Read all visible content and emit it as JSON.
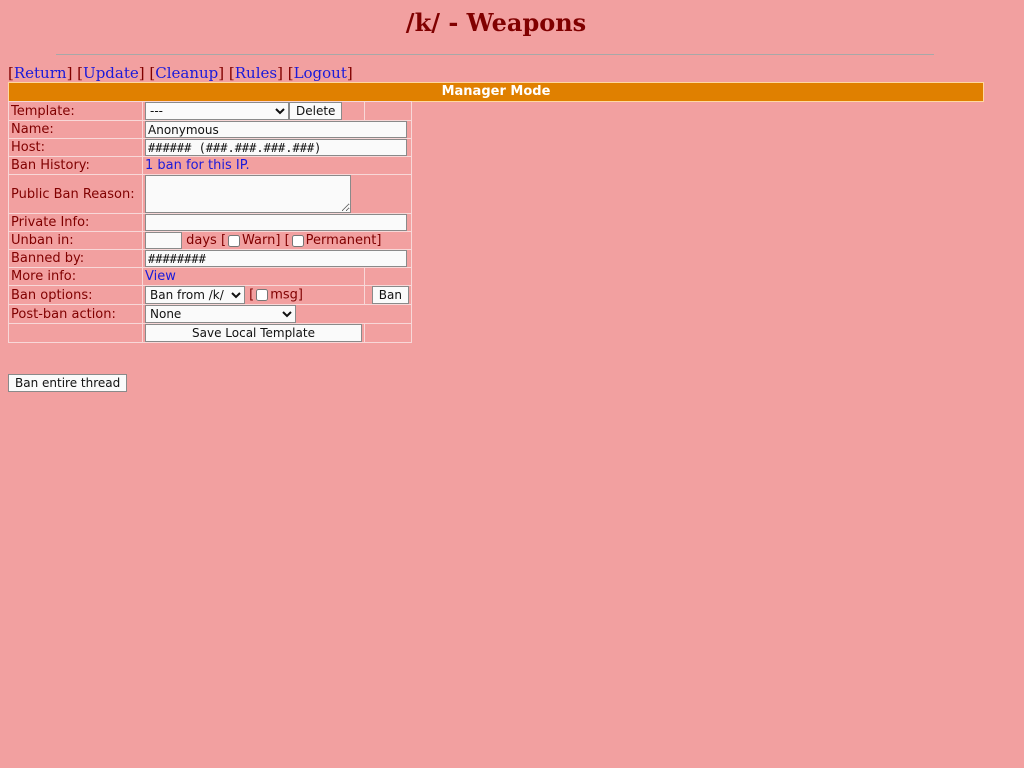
{
  "header": {
    "title": "/k/ - Weapons"
  },
  "nav": {
    "links": [
      "Return",
      "Update",
      "Cleanup",
      "Rules",
      "Logout"
    ]
  },
  "mode_bar": {
    "label": "Manager Mode"
  },
  "form": {
    "template": {
      "label": "Template:",
      "selected": "---",
      "delete_label": "Delete"
    },
    "name": {
      "label": "Name:",
      "value": "Anonymous"
    },
    "host": {
      "label": "Host:",
      "value": "###### (###.###.###.###)"
    },
    "ban_history": {
      "label": "Ban History:",
      "link_text": "1 ban for this IP."
    },
    "public_reason": {
      "label": "Public Ban Reason:",
      "value": ""
    },
    "private_info": {
      "label": "Private Info:",
      "value": ""
    },
    "unban_in": {
      "label": "Unban in:",
      "value": "",
      "days_text": "days [",
      "warn_label": "Warn]",
      "bracket_open": "[",
      "permanent_label": "Permanent]"
    },
    "banned_by": {
      "label": "Banned by:",
      "value": "########"
    },
    "more_info": {
      "label": "More info:",
      "link_text": "View"
    },
    "ban_options": {
      "label": "Ban options:",
      "selected": "Ban from /k/",
      "bracket_open": "[",
      "msg_label": "msg]",
      "ban_label": "Ban"
    },
    "post_ban_action": {
      "label": "Post-ban action:",
      "selected": "None"
    },
    "save_template_label": "Save Local Template"
  },
  "ban_thread_label": "Ban entire thread"
}
